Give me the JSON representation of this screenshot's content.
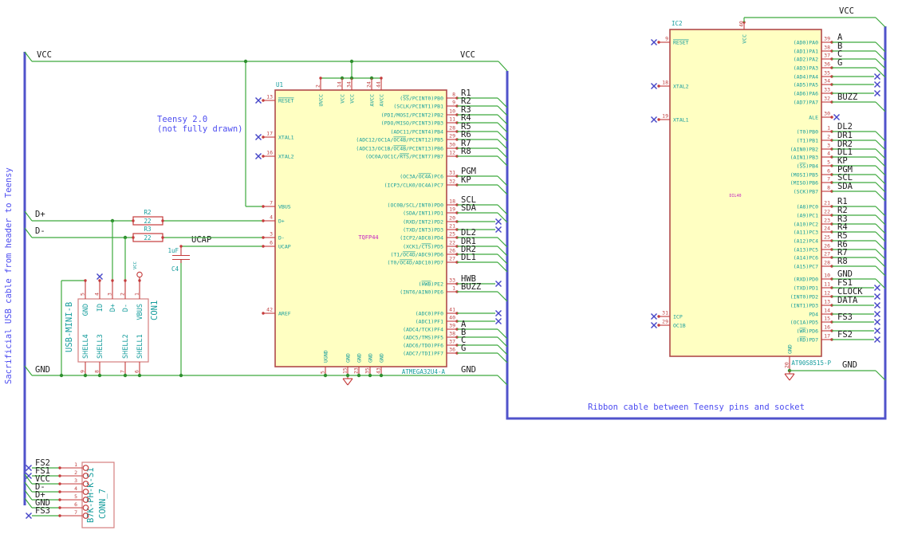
{
  "captions": {
    "sacrificial": "Sacrificial USB cable from header to Teensy",
    "teensy_line1": "Teensy 2.0",
    "teensy_line2": "(not fully drawn)",
    "ribbon": "Ribbon cable between Teensy pins and socket"
  },
  "net_labels": {
    "vcc": "VCC",
    "gnd": "GND",
    "ucap": "UCAP",
    "d_plus": "D+",
    "d_minus": "D-"
  },
  "colors": {
    "wire": "#3da93d",
    "bus": "#5053cb",
    "component_outline": "#b04a4a",
    "body_fill": "#ffffc2",
    "pin_text": "#149c9c",
    "net_text": "#1c1c1c",
    "note_text": "#4d4df0",
    "package_text": "#c322c3",
    "no_connect": "#4646c8"
  },
  "components": {
    "U1": {
      "ref": "U1",
      "value": "ATMEGA32U4-A",
      "package": "TQFP44",
      "top_pins": [
        {
          "num": "2",
          "name": "UVCC"
        },
        {
          "num": "14",
          "name": "VCC"
        },
        {
          "num": "34",
          "name": "VCC"
        },
        {
          "num": "24",
          "name": "AVCC"
        },
        {
          "num": "44",
          "name": "AVCC"
        }
      ],
      "bottom_pins": [
        {
          "num": "5",
          "name": "UGND"
        },
        {
          "num": "15",
          "name": "GND"
        },
        {
          "num": "23",
          "name": "GND"
        },
        {
          "num": "35",
          "name": "GND"
        },
        {
          "num": "43",
          "name": "GND"
        }
      ],
      "left_pins": [
        {
          "num": "13",
          "name": "~RESET~",
          "nc": true
        },
        {
          "num": "17",
          "name": "XTAL1",
          "nc": true
        },
        {
          "num": "16",
          "name": "XTAL2",
          "nc": true
        },
        {
          "num": "7",
          "name": "VBUS"
        },
        {
          "num": "4",
          "name": "D+"
        },
        {
          "num": "3",
          "name": "D-"
        },
        {
          "num": "6",
          "name": "UCAP"
        },
        {
          "num": "42",
          "name": "AREF"
        }
      ],
      "right_pins": [
        {
          "num": "8",
          "name": "(~SS~/PCINT0)PB0",
          "net": "R1",
          "term": "bus"
        },
        {
          "num": "9",
          "name": "(SCLK/PCINT1)PB1",
          "net": "R2",
          "term": "bus"
        },
        {
          "num": "10",
          "name": "(PDI/MOSI/PCINT2)PB2",
          "net": "R3",
          "term": "bus"
        },
        {
          "num": "11",
          "name": "(PDO/MISO/PCINT3)PB3",
          "net": "R4",
          "term": "bus"
        },
        {
          "num": "28",
          "name": "(ADC11/PCINT4)PB4",
          "net": "R5",
          "term": "bus"
        },
        {
          "num": "29",
          "name": "(ADC12/OC1A/~OC4B~/PCINT12)PB5",
          "net": "R6",
          "term": "bus"
        },
        {
          "num": "30",
          "name": "(ADC13/OC1B/~OC4B~/PCINT13)PB6",
          "net": "R7",
          "term": "bus"
        },
        {
          "num": "12",
          "name": "(OC0A/OC1C/~RTS~/PCINT7)PB7",
          "net": "R8",
          "term": "bus"
        },
        {
          "num": "31",
          "name": "(OC3A/~OC4A~)PC6",
          "net": "PGM",
          "term": "bus"
        },
        {
          "num": "32",
          "name": "(ICP3/CLK0/OC4A)PC7",
          "net": "KP",
          "term": "bus"
        },
        {
          "num": "18",
          "name": "(OC0B/SCL/INT0)PD0",
          "net": "SCL",
          "term": "bus"
        },
        {
          "num": "19",
          "name": "(SDA/INT1)PD1",
          "net": "SDA",
          "term": "bus"
        },
        {
          "num": "20",
          "name": "(RXD/INT2)PD2",
          "net": "",
          "term": "x"
        },
        {
          "num": "21",
          "name": "(TXD/INT3)PD3",
          "net": "",
          "term": "x"
        },
        {
          "num": "25",
          "name": "(ICP2/ADC8)PD4",
          "net": "DL2",
          "term": "bus"
        },
        {
          "num": "22",
          "name": "(XCK1/~CTS~)PD5",
          "net": "DR1",
          "term": "bus"
        },
        {
          "num": "26",
          "name": "(T1/~OC4D~/ADC9)PD6",
          "net": "DR2",
          "term": "bus"
        },
        {
          "num": "27",
          "name": "(T0/~OC4D~/ADC10)PD7",
          "net": "DL1",
          "term": "bus"
        },
        {
          "num": "33",
          "name": "(~HWB~)PE2",
          "net": "HWB",
          "term": "x"
        },
        {
          "num": "1",
          "name": "(INT6/AIN0)PE6",
          "net": "BUZZ",
          "term": "bus"
        },
        {
          "num": "41",
          "name": "(ADC0)PF0",
          "net": "",
          "term": "x"
        },
        {
          "num": "40",
          "name": "(ADC1)PF1",
          "net": "",
          "term": "x"
        },
        {
          "num": "39",
          "name": "(ADC4/TCK)PF4",
          "net": "A",
          "term": "bus"
        },
        {
          "num": "38",
          "name": "(ADC5/TMS)PF5",
          "net": "B",
          "term": "bus"
        },
        {
          "num": "37",
          "name": "(ADC6/TDO)PF6",
          "net": "C",
          "term": "bus"
        },
        {
          "num": "36",
          "name": "(ADC7/TDI)PF7",
          "net": "G",
          "term": "bus"
        }
      ]
    },
    "IC2": {
      "ref": "IC2",
      "value": "AT90S8515-P",
      "package": "DIL40",
      "top_pins": [
        {
          "num": "40",
          "name": "VCC"
        }
      ],
      "bottom_pins": [
        {
          "num": "20",
          "name": "GND"
        }
      ],
      "left_pins": [
        {
          "num": "9",
          "name": "~RESET~",
          "nc": true
        },
        {
          "num": "18",
          "name": "XTAL2",
          "nc": true
        },
        {
          "num": "19",
          "name": "XTAL1",
          "nc": true
        },
        {
          "num": "31",
          "name": "ICP",
          "nc": true
        },
        {
          "num": "29",
          "name": "OC1B",
          "nc": true
        }
      ],
      "right_pins": [
        {
          "num": "39",
          "name": "(AD0)PA0",
          "net": "A",
          "term": "bus"
        },
        {
          "num": "38",
          "name": "(AD1)PA1",
          "net": "B",
          "term": "bus"
        },
        {
          "num": "37",
          "name": "(AD2)PA2",
          "net": "C",
          "term": "bus"
        },
        {
          "num": "36",
          "name": "(AD3)PA3",
          "net": "G",
          "term": "bus"
        },
        {
          "num": "35",
          "name": "(AD4)PA4",
          "net": "",
          "term": "x"
        },
        {
          "num": "34",
          "name": "(AD5)PA5",
          "net": "",
          "term": "x"
        },
        {
          "num": "33",
          "name": "(AD6)PA6",
          "net": "",
          "term": "x"
        },
        {
          "num": "32",
          "name": "(AD7)PA7",
          "net": "BUZZ",
          "term": "bus"
        },
        {
          "num": "30",
          "name": "ALE",
          "net": "",
          "term": "x_short"
        },
        {
          "num": "1",
          "name": "(T0)PB0",
          "net": "DL2",
          "term": "bus"
        },
        {
          "num": "2",
          "name": "(T1)PB1",
          "net": "DR1",
          "term": "bus"
        },
        {
          "num": "3",
          "name": "(AIN0)PB2",
          "net": "DR2",
          "term": "bus"
        },
        {
          "num": "4",
          "name": "(AIN1)PB3",
          "net": "DL1",
          "term": "bus"
        },
        {
          "num": "5",
          "name": "(~SS~)PB4",
          "net": "KP",
          "term": "bus"
        },
        {
          "num": "6",
          "name": "(MOSI)PB5",
          "net": "PGM",
          "term": "bus"
        },
        {
          "num": "7",
          "name": "(MISO)PB6",
          "net": "SCL",
          "term": "bus"
        },
        {
          "num": "8",
          "name": "(SCK)PB7",
          "net": "SDA",
          "term": "bus"
        },
        {
          "num": "21",
          "name": "(A8)PC0",
          "net": "R1",
          "term": "bus"
        },
        {
          "num": "22",
          "name": "(A9)PC1",
          "net": "R2",
          "term": "bus"
        },
        {
          "num": "23",
          "name": "(A10)PC2",
          "net": "R3",
          "term": "bus"
        },
        {
          "num": "24",
          "name": "(A11)PC3",
          "net": "R4",
          "term": "bus"
        },
        {
          "num": "25",
          "name": "(A12)PC4",
          "net": "R5",
          "term": "bus"
        },
        {
          "num": "26",
          "name": "(A13)PC5",
          "net": "R6",
          "term": "bus"
        },
        {
          "num": "27",
          "name": "(A14)PC6",
          "net": "R7",
          "term": "bus"
        },
        {
          "num": "28",
          "name": "(A15)PC7",
          "net": "R8",
          "term": "bus"
        },
        {
          "num": "10",
          "name": "(RXD)PD0",
          "net": "GND",
          "term": "bus"
        },
        {
          "num": "11",
          "name": "(TXD)PD1",
          "net": "FS1",
          "term": "x"
        },
        {
          "num": "12",
          "name": "(INT0)PD2",
          "net": "CLOCK",
          "term": "x"
        },
        {
          "num": "13",
          "name": "(INT1)PD3",
          "net": "DATA",
          "term": "x"
        },
        {
          "num": "14",
          "name": "PD4",
          "net": "",
          "term": "x"
        },
        {
          "num": "15",
          "name": "(OC1A)PD5",
          "net": "FS3",
          "term": "x"
        },
        {
          "num": "16",
          "name": "(~WR~)PD6",
          "net": "",
          "term": "x"
        },
        {
          "num": "17",
          "name": "(~RD~)PD7",
          "net": "FS2",
          "term": "x"
        }
      ]
    },
    "CON1": {
      "ref": "CON1",
      "value": "USB-MINI-B",
      "top_pins": [
        {
          "num": "5",
          "name": "GND"
        },
        {
          "num": "4",
          "name": "ID"
        },
        {
          "num": "3",
          "name": "D+"
        },
        {
          "num": "2",
          "name": "D-"
        },
        {
          "num": "1",
          "name": "VBUS"
        }
      ],
      "bottom_pins": [
        {
          "num": "9",
          "name": "SHELL4"
        },
        {
          "num": "8",
          "name": "SHELL3"
        },
        {
          "num": "7",
          "name": "SHELL2"
        },
        {
          "num": "6",
          "name": "SHELL1"
        }
      ]
    },
    "CONN7": {
      "ref": "CONN_7",
      "value": "B7K-PH-K-S1",
      "pins": [
        {
          "num": "1",
          "label": "FS2",
          "term": "x"
        },
        {
          "num": "2",
          "label": "FS1",
          "term": "x"
        },
        {
          "num": "3",
          "label": "VCC",
          "term": "bus"
        },
        {
          "num": "4",
          "label": "D-",
          "term": "bus"
        },
        {
          "num": "5",
          "label": "D+",
          "term": "bus"
        },
        {
          "num": "6",
          "label": "GND",
          "term": "bus"
        },
        {
          "num": "7",
          "label": "FS3",
          "term": "x"
        }
      ]
    },
    "R2": {
      "ref": "R2",
      "value": "22"
    },
    "R3": {
      "ref": "R3",
      "value": "22"
    },
    "C4": {
      "ref": "C4",
      "value": "1uF"
    },
    "PWR1": {
      "value": "VCC"
    }
  }
}
